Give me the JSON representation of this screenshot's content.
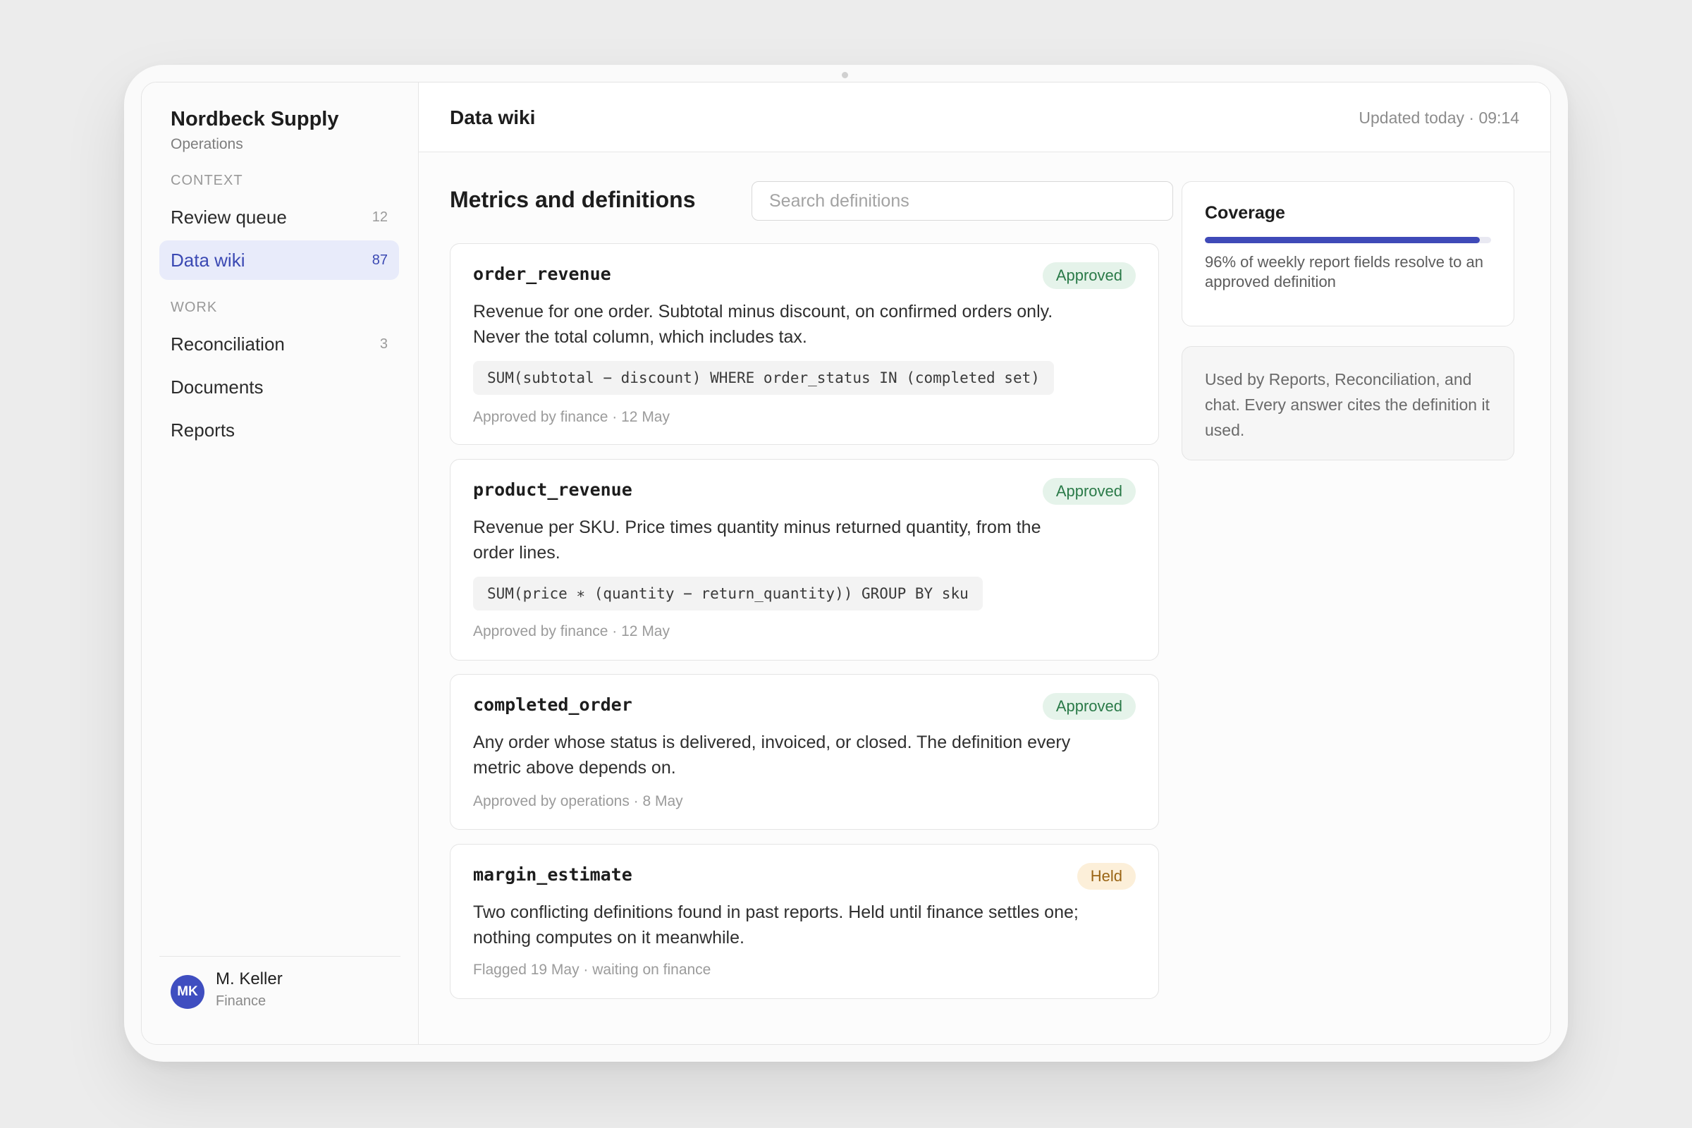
{
  "org": {
    "name": "Nordbeck Supply",
    "team": "Operations"
  },
  "nav": {
    "sections": [
      {
        "heading": "CONTEXT",
        "items": [
          {
            "label": "Review queue",
            "count": "12",
            "active": false
          },
          {
            "label": "Data wiki",
            "count": "87",
            "active": true
          }
        ]
      },
      {
        "heading": "WORK",
        "items": [
          {
            "label": "Reconciliation",
            "count": "3",
            "active": false
          },
          {
            "label": "Documents",
            "count": "",
            "active": false
          },
          {
            "label": "Reports",
            "count": "",
            "active": false
          }
        ]
      }
    ]
  },
  "user": {
    "initials": "MK",
    "name": "M. Keller",
    "role": "Finance"
  },
  "header": {
    "title": "Data wiki",
    "updated": "Updated today · 09:14"
  },
  "main": {
    "section_title": "Metrics and definitions",
    "search_placeholder": "Search definitions",
    "definitions": [
      {
        "name": "order_revenue",
        "status": "Approved",
        "description": "Revenue for one order. Subtotal minus discount, on confirmed orders only. Never the total column, which includes tax.",
        "code": "SUM(subtotal − discount) WHERE order_status IN (completed set)",
        "meta": "Approved by finance · 12 May"
      },
      {
        "name": "product_revenue",
        "status": "Approved",
        "description": "Revenue per SKU. Price times quantity minus returned quantity, from the order lines.",
        "code": "SUM(price ∗ (quantity − return_quantity)) GROUP BY sku",
        "meta": "Approved by finance · 12 May"
      },
      {
        "name": "completed_order",
        "status": "Approved",
        "description": "Any order whose status is delivered, invoiced, or closed. The definition every metric above depends on.",
        "code": "",
        "meta": "Approved by operations · 8 May"
      },
      {
        "name": "margin_estimate",
        "status": "Held",
        "description": "Two conflicting definitions found in past reports. Held until finance settles one; nothing computes on it meanwhile.",
        "code": "",
        "meta": "Flagged 19 May · waiting on finance"
      }
    ]
  },
  "coverage": {
    "title": "Coverage",
    "percent": 96,
    "text": "96% of weekly report fields resolve to an approved definition",
    "bar_color": "#3f4ab8"
  },
  "usage_note": "Used by Reports, Reconciliation, and chat. Every answer cites the definition it used.",
  "colors": {
    "accent": "#3f4ec0",
    "approved_bg": "#e5f3ea",
    "approved_text": "#2a7a48",
    "held_bg": "#fcefd9",
    "held_text": "#9a6515"
  }
}
